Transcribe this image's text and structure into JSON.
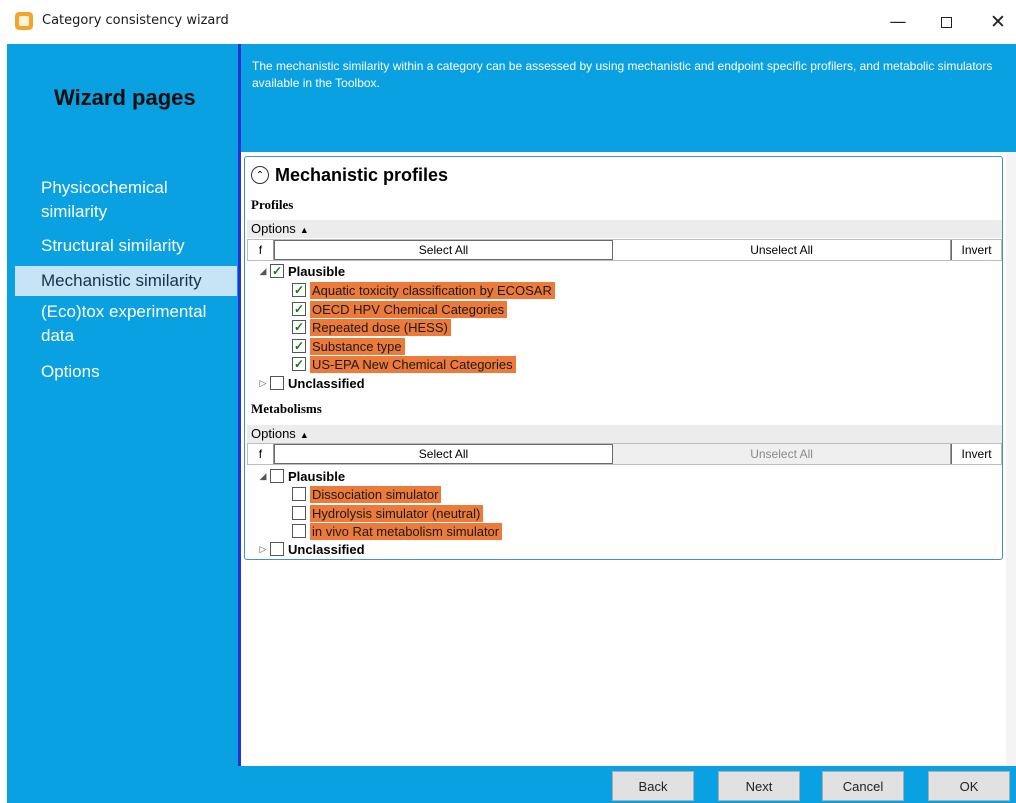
{
  "window": {
    "title": "Category consistency wizard",
    "minimize_glyph": "—",
    "close_glyph": "✕"
  },
  "sidebar": {
    "title": "Wizard pages",
    "items": [
      {
        "label": "Physicochemical similarity"
      },
      {
        "label": "Structural similarity"
      },
      {
        "label": "Mechanistic similarity",
        "selected": true
      },
      {
        "label": "(Eco)tox experimental data"
      },
      {
        "label": "Options"
      }
    ]
  },
  "intro_text": "The mechanistic similarity within a category can be assessed by using mechanistic and endpoint specific profilers, and metabolic simulators available in the Toolbox.",
  "section": {
    "title": "Mechanistic profiles",
    "collapse_glyph": "⌃"
  },
  "profiles": {
    "label": "Profiles",
    "options_label": "Options",
    "f_label": "f",
    "select_all": "Select All",
    "unselect_all": "Unselect All",
    "invert": "Invert",
    "groups": [
      {
        "label": "Plausible",
        "checked": true,
        "expanded": true,
        "items": [
          {
            "label": "Aquatic toxicity classification by ECOSAR",
            "checked": true
          },
          {
            "label": "OECD HPV Chemical Categories",
            "checked": true
          },
          {
            "label": "Repeated dose (HESS)",
            "checked": true
          },
          {
            "label": "Substance type",
            "checked": true
          },
          {
            "label": "US-EPA New Chemical Categories",
            "checked": true
          }
        ]
      },
      {
        "label": "Unclassified",
        "checked": false,
        "expanded": false
      }
    ]
  },
  "metabolisms": {
    "label": "Metabolisms",
    "options_label": "Options",
    "f_label": "f",
    "select_all": "Select All",
    "unselect_all": "Unselect All",
    "invert": "Invert",
    "groups": [
      {
        "label": "Plausible",
        "checked": false,
        "expanded": true,
        "items": [
          {
            "label": "Dissociation simulator",
            "checked": false
          },
          {
            "label": "Hydrolysis simulator (neutral)",
            "checked": false
          },
          {
            "label": "in vivo Rat metabolism simulator",
            "checked": false
          }
        ]
      },
      {
        "label": "Unclassified",
        "checked": false,
        "expanded": false
      }
    ]
  },
  "footer": {
    "back": "Back",
    "next": "Next",
    "cancel": "Cancel",
    "ok": "OK"
  },
  "colors": {
    "frame": "#0aa1e2",
    "highlight": "#ec7a3b",
    "selected_nav": "#c7e4f7"
  }
}
